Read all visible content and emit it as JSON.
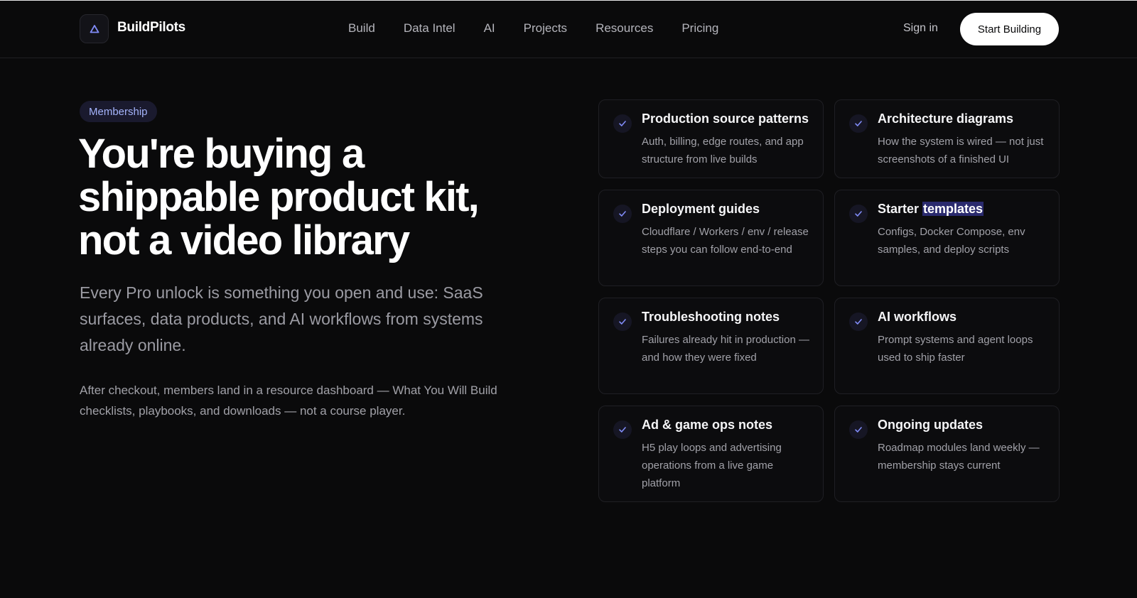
{
  "brand": {
    "name": "BuildPilots",
    "logo_icon": "triangle-logo-icon",
    "accent": "#818cf8"
  },
  "nav": {
    "items": [
      "Build",
      "Data Intel",
      "AI",
      "Projects",
      "Resources",
      "Pricing"
    ],
    "sign_in": "Sign in",
    "cta": "Start Building"
  },
  "hero": {
    "badge": "Membership",
    "headline_lines": [
      "You're buying a",
      "shippable product kit,",
      "not a video library"
    ],
    "subhead": "Every Pro unlock is something you open and use: SaaS surfaces, data products, and AI workflows from systems already online.",
    "note": "After checkout, members land in a resource dashboard — What You Will Build checklists, playbooks, and downloads — not a course player."
  },
  "features": [
    {
      "title": "Production source patterns",
      "desc": "Auth, billing, edge routes, and app structure from live builds"
    },
    {
      "title": "Architecture diagrams",
      "desc": "How the system is wired — not just screenshots of a finished UI"
    },
    {
      "title": "Deployment guides",
      "desc": "Cloudflare / Workers / env / release steps you can follow end-to-end"
    },
    {
      "title_prefix": "Starter ",
      "title_highlight": "templates",
      "desc": "Configs, Docker Compose, env samples, and deploy scripts"
    },
    {
      "title": "Troubleshooting notes",
      "desc": "Failures already hit in production — and how they were fixed"
    },
    {
      "title": "AI workflows",
      "desc": "Prompt systems and agent loops used to ship faster"
    },
    {
      "title": "Ad & game ops notes",
      "desc": "H5 play loops and advertising operations from a live game platform"
    },
    {
      "title": "Ongoing updates",
      "desc": "Roadmap modules land weekly — membership stays current"
    }
  ]
}
